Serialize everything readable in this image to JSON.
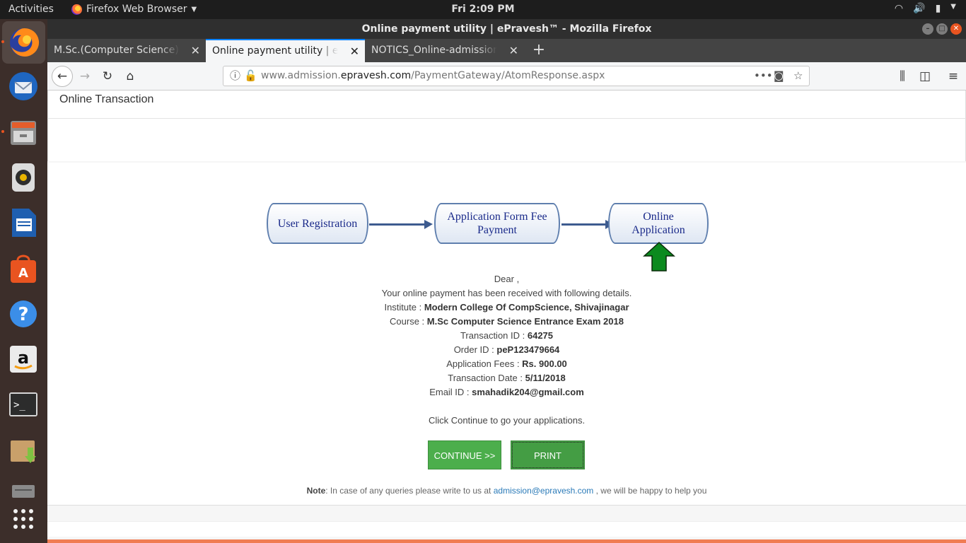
{
  "topbar": {
    "activities": "Activities",
    "app_menu": "Firefox Web Browser",
    "clock": "Fri  2:09 PM"
  },
  "dock": {
    "items": [
      "firefox-icon",
      "thunderbird-icon",
      "files-icon",
      "rhythmbox-icon",
      "writer-icon",
      "software-center-icon",
      "help-icon",
      "amazon-icon",
      "terminal-icon",
      "archive-manager-icon",
      "drive-icon",
      "show-apps-icon"
    ]
  },
  "window": {
    "title": "Online payment utility | ePravesh™ - Mozilla Firefox"
  },
  "tabs": [
    {
      "label": "M.Sc.(Computer Science) En"
    },
    {
      "label": "Online payment utility | ePra"
    },
    {
      "label": "NOTICS_Online-admission-p"
    }
  ],
  "urlbar": {
    "prefix": "www.admission.",
    "domain": "epravesh.com",
    "path": "/PaymentGateway/AtomResponse.aspx"
  },
  "page": {
    "panel_title": "Online Transaction",
    "flow": {
      "step1": "User Registration",
      "step2": "Application Form Fee Payment",
      "step3": "Online Application"
    },
    "details": {
      "greeting": "Dear  ,",
      "intro": "Your online payment has been received with following details.",
      "institute_label": "Institute : ",
      "institute": "Modern College Of CompScience, Shivajinagar",
      "course_label": "Course : ",
      "course": "M.Sc Computer Science Entrance Exam 2018",
      "txn_label": "Transaction ID : ",
      "txn": "64275",
      "order_label": "Order ID : ",
      "order": "peP123479664",
      "fees_label": "Application Fees : ",
      "fees": "Rs. 900.00",
      "date_label": "Transaction Date : ",
      "date": "5/11/2018",
      "email_label": "Email ID : ",
      "email": "smahadik204@gmail.com",
      "continue_msg": "Click Continue to go your applications."
    },
    "buttons": {
      "continue": "CONTINUE >>",
      "print": "PRINT"
    },
    "note": {
      "label": "Note",
      "text": ": In case of any queries please write to us at ",
      "email": "admission@epravesh.com",
      "tail": " , we will be happy to help you"
    }
  }
}
